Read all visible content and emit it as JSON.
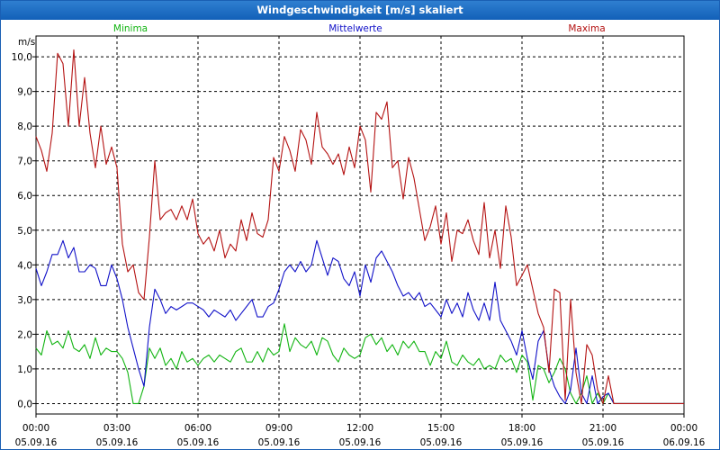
{
  "chart_data": {
    "type": "line",
    "title": "Windgeschwindigkeit [m/s] skaliert",
    "ylabel": "m/s",
    "ylim": [
      -0.3,
      10.6
    ],
    "grid": true,
    "x_ticks": [
      {
        "hours": 0,
        "time": "00:00",
        "date": "05.09.16"
      },
      {
        "hours": 3,
        "time": "03:00",
        "date": "05.09.16"
      },
      {
        "hours": 6,
        "time": "06:00",
        "date": "05.09.16"
      },
      {
        "hours": 9,
        "time": "09:00",
        "date": "05.09.16"
      },
      {
        "hours": 12,
        "time": "12:00",
        "date": "05.09.16"
      },
      {
        "hours": 15,
        "time": "15:00",
        "date": "05.09.16"
      },
      {
        "hours": 18,
        "time": "18:00",
        "date": "05.09.16"
      },
      {
        "hours": 21,
        "time": "21:00",
        "date": "05.09.16"
      },
      {
        "hours": 24,
        "time": "00:00",
        "date": "06.09.16"
      }
    ],
    "y_ticks": [
      "0,0",
      "1,0",
      "2,0",
      "3,0",
      "4,0",
      "5,0",
      "6,0",
      "7,0",
      "8,0",
      "9,0",
      "10,0"
    ],
    "x_range": [
      0,
      24
    ],
    "series": [
      {
        "name": "Minima",
        "color": "#12b412",
        "x": [
          0,
          0.2,
          0.4,
          0.6,
          0.8,
          1.0,
          1.2,
          1.4,
          1.6,
          1.8,
          2.0,
          2.2,
          2.4,
          2.6,
          2.8,
          3.0,
          3.2,
          3.4,
          3.6,
          3.8,
          4.0,
          4.2,
          4.4,
          4.6,
          4.8,
          5.0,
          5.2,
          5.4,
          5.6,
          5.8,
          6.0,
          6.2,
          6.4,
          6.6,
          6.8,
          7.0,
          7.2,
          7.4,
          7.6,
          7.8,
          8.0,
          8.2,
          8.4,
          8.6,
          8.8,
          9.0,
          9.2,
          9.4,
          9.6,
          9.8,
          10.0,
          10.2,
          10.4,
          10.6,
          10.8,
          11.0,
          11.2,
          11.4,
          11.6,
          11.8,
          12.0,
          12.2,
          12.4,
          12.6,
          12.8,
          13.0,
          13.2,
          13.4,
          13.6,
          13.8,
          14.0,
          14.2,
          14.4,
          14.6,
          14.8,
          15.0,
          15.2,
          15.4,
          15.6,
          15.8,
          16.0,
          16.2,
          16.4,
          16.6,
          16.8,
          17.0,
          17.2,
          17.4,
          17.6,
          17.8,
          18.0,
          18.2,
          18.4,
          18.6,
          18.8,
          19.0,
          19.2,
          19.4,
          19.6,
          19.8,
          20.0,
          20.2,
          20.4,
          20.6,
          20.8,
          21.0,
          21.2,
          21.4,
          21.6,
          21.8,
          22.0,
          22.5,
          23.0,
          23.5,
          24.0
        ],
        "y": [
          1.6,
          1.4,
          2.1,
          1.7,
          1.8,
          1.6,
          2.1,
          1.6,
          1.5,
          1.7,
          1.3,
          1.9,
          1.4,
          1.6,
          1.5,
          1.5,
          1.3,
          0.9,
          0.0,
          0.0,
          0.5,
          1.6,
          1.3,
          1.6,
          1.1,
          1.3,
          1.0,
          1.5,
          1.2,
          1.3,
          1.1,
          1.3,
          1.4,
          1.2,
          1.4,
          1.3,
          1.2,
          1.5,
          1.6,
          1.2,
          1.2,
          1.5,
          1.2,
          1.6,
          1.4,
          1.5,
          2.3,
          1.5,
          1.9,
          1.7,
          1.6,
          1.8,
          1.4,
          1.9,
          1.8,
          1.4,
          1.2,
          1.6,
          1.4,
          1.3,
          1.4,
          1.9,
          2.0,
          1.7,
          1.9,
          1.5,
          1.7,
          1.4,
          1.8,
          1.6,
          1.8,
          1.5,
          1.5,
          1.1,
          1.5,
          1.3,
          1.8,
          1.2,
          1.1,
          1.4,
          1.2,
          1.1,
          1.3,
          1.0,
          1.1,
          1.0,
          1.4,
          1.2,
          1.3,
          0.9,
          1.4,
          1.2,
          0.1,
          1.1,
          1.0,
          0.6,
          0.9,
          1.3,
          1.0,
          0.3,
          0.0,
          0.3,
          0.8,
          0.0,
          0.3,
          0.0,
          0.3,
          0.0,
          0.0,
          0.0,
          0.0,
          0.0,
          0.0,
          0.0,
          0.0
        ]
      },
      {
        "name": "Mittelwerte",
        "color": "#1212c8",
        "x": [
          0,
          0.2,
          0.4,
          0.6,
          0.8,
          1.0,
          1.2,
          1.4,
          1.6,
          1.8,
          2.0,
          2.2,
          2.4,
          2.6,
          2.8,
          3.0,
          3.2,
          3.4,
          3.6,
          3.8,
          4.0,
          4.2,
          4.4,
          4.6,
          4.8,
          5.0,
          5.2,
          5.4,
          5.6,
          5.8,
          6.0,
          6.2,
          6.4,
          6.6,
          6.8,
          7.0,
          7.2,
          7.4,
          7.6,
          7.8,
          8.0,
          8.2,
          8.4,
          8.6,
          8.8,
          9.0,
          9.2,
          9.4,
          9.6,
          9.8,
          10.0,
          10.2,
          10.4,
          10.6,
          10.8,
          11.0,
          11.2,
          11.4,
          11.6,
          11.8,
          12.0,
          12.2,
          12.4,
          12.6,
          12.8,
          13.0,
          13.2,
          13.4,
          13.6,
          13.8,
          14.0,
          14.2,
          14.4,
          14.6,
          14.8,
          15.0,
          15.2,
          15.4,
          15.6,
          15.8,
          16.0,
          16.2,
          16.4,
          16.6,
          16.8,
          17.0,
          17.2,
          17.4,
          17.6,
          17.8,
          18.0,
          18.2,
          18.4,
          18.6,
          18.8,
          19.0,
          19.2,
          19.4,
          19.6,
          19.8,
          20.0,
          20.2,
          20.4,
          20.6,
          20.8,
          21.0,
          21.2,
          21.4,
          21.6,
          21.8,
          22.0,
          22.5,
          23.0,
          23.5,
          24.0
        ],
        "y": [
          3.9,
          3.4,
          3.8,
          4.3,
          4.3,
          4.7,
          4.2,
          4.5,
          3.8,
          3.8,
          4.0,
          3.9,
          3.4,
          3.4,
          4.0,
          3.6,
          3.0,
          2.2,
          1.6,
          1.0,
          0.5,
          2.2,
          3.3,
          3.0,
          2.6,
          2.8,
          2.7,
          2.8,
          2.9,
          2.9,
          2.8,
          2.7,
          2.5,
          2.7,
          2.6,
          2.5,
          2.7,
          2.4,
          2.6,
          2.8,
          3.0,
          2.5,
          2.5,
          2.8,
          2.9,
          3.3,
          3.8,
          4.0,
          3.8,
          4.1,
          3.8,
          4.0,
          4.7,
          4.2,
          3.7,
          4.2,
          4.1,
          3.6,
          3.4,
          3.8,
          3.1,
          4.0,
          3.5,
          4.2,
          4.4,
          4.1,
          3.8,
          3.4,
          3.1,
          3.2,
          3.0,
          3.2,
          2.8,
          2.9,
          2.7,
          2.5,
          3.0,
          2.6,
          2.9,
          2.5,
          3.2,
          2.7,
          2.4,
          2.9,
          2.4,
          3.5,
          2.4,
          2.1,
          1.8,
          1.4,
          2.1,
          1.3,
          0.7,
          1.8,
          2.1,
          1.0,
          0.5,
          0.2,
          0.0,
          0.4,
          1.6,
          0.3,
          0.0,
          0.8,
          0.0,
          0.2,
          0.3,
          0.0,
          0.0,
          0.0,
          0.0,
          0.0,
          0.0,
          0.0,
          0.0
        ]
      },
      {
        "name": "Maxima",
        "color": "#b41212",
        "x": [
          0,
          0.2,
          0.4,
          0.6,
          0.8,
          1.0,
          1.2,
          1.4,
          1.6,
          1.8,
          2.0,
          2.2,
          2.4,
          2.6,
          2.8,
          3.0,
          3.2,
          3.4,
          3.6,
          3.8,
          4.0,
          4.2,
          4.4,
          4.6,
          4.8,
          5.0,
          5.2,
          5.4,
          5.6,
          5.8,
          6.0,
          6.2,
          6.4,
          6.6,
          6.8,
          7.0,
          7.2,
          7.4,
          7.6,
          7.8,
          8.0,
          8.2,
          8.4,
          8.6,
          8.8,
          9.0,
          9.2,
          9.4,
          9.6,
          9.8,
          10.0,
          10.2,
          10.4,
          10.6,
          10.8,
          11.0,
          11.2,
          11.4,
          11.6,
          11.8,
          12.0,
          12.2,
          12.4,
          12.6,
          12.8,
          13.0,
          13.2,
          13.4,
          13.6,
          13.8,
          14.0,
          14.2,
          14.4,
          14.6,
          14.8,
          15.0,
          15.2,
          15.4,
          15.6,
          15.8,
          16.0,
          16.2,
          16.4,
          16.6,
          16.8,
          17.0,
          17.2,
          17.4,
          17.6,
          17.8,
          18.0,
          18.2,
          18.4,
          18.6,
          18.8,
          19.0,
          19.2,
          19.4,
          19.6,
          19.8,
          20.0,
          20.2,
          20.4,
          20.6,
          20.8,
          21.0,
          21.2,
          21.4,
          21.6,
          21.8,
          22.0,
          22.5,
          23.0,
          23.5,
          24.0
        ],
        "y": [
          7.7,
          7.3,
          6.7,
          7.8,
          10.1,
          9.8,
          8.0,
          10.2,
          8.0,
          9.4,
          7.8,
          6.8,
          8.0,
          6.9,
          7.4,
          6.8,
          4.6,
          3.8,
          4.0,
          3.2,
          3.0,
          4.8,
          7.0,
          5.3,
          5.5,
          5.6,
          5.3,
          5.7,
          5.3,
          5.9,
          4.9,
          4.6,
          4.8,
          4.4,
          5.0,
          4.2,
          4.6,
          4.4,
          5.3,
          4.7,
          5.5,
          4.9,
          4.8,
          5.3,
          7.1,
          6.7,
          7.7,
          7.3,
          6.7,
          7.9,
          7.6,
          6.9,
          8.4,
          7.4,
          7.2,
          6.9,
          7.2,
          6.6,
          7.4,
          6.8,
          8.0,
          7.6,
          6.1,
          8.4,
          8.2,
          8.7,
          6.8,
          7.0,
          5.9,
          7.1,
          6.5,
          5.6,
          4.7,
          5.1,
          5.7,
          4.6,
          5.5,
          4.1,
          5.0,
          4.9,
          5.3,
          4.7,
          4.3,
          5.8,
          4.2,
          5.0,
          3.9,
          5.7,
          4.8,
          3.4,
          3.7,
          4.0,
          3.3,
          2.6,
          2.2,
          0.9,
          3.3,
          3.2,
          0.1,
          3.0,
          0.9,
          0.0,
          1.7,
          1.4,
          0.4,
          0.0,
          0.8,
          0.0,
          0.0,
          0.0,
          0.0,
          0.0,
          0.0,
          0.0,
          0.0
        ]
      }
    ]
  }
}
